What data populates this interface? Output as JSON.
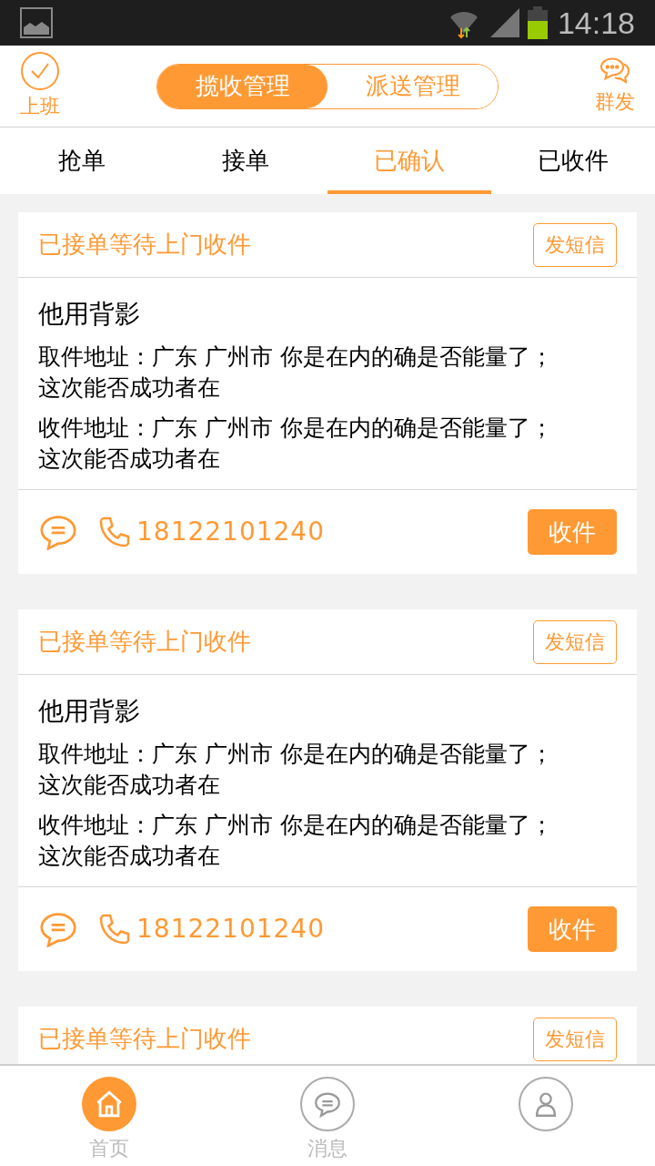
{
  "status_bar": {
    "time": "14:18"
  },
  "header": {
    "left_action": "上班",
    "right_action": "群发",
    "segments": [
      {
        "label": "揽收管理",
        "selected": true
      },
      {
        "label": "派送管理",
        "selected": false
      }
    ]
  },
  "tabs": [
    {
      "label": "抢单",
      "selected": false
    },
    {
      "label": "接单",
      "selected": false
    },
    {
      "label": "已确认",
      "selected": true
    },
    {
      "label": "已收件",
      "selected": false
    }
  ],
  "orders": [
    {
      "status": "已接单等待上门收件",
      "sms_button": "发短信",
      "name": "他用背影",
      "pickup": "取件地址：广东 广州市 你是在内的确是否能量了；这次能否成功者在",
      "delivery": "收件地址：广东 广州市 你是在内的确是否能量了；这次能否成功者在",
      "phone": "18122101240",
      "action": "收件"
    },
    {
      "status": "已接单等待上门收件",
      "sms_button": "发短信",
      "name": "他用背影",
      "pickup": "取件地址：广东 广州市 你是在内的确是否能量了；这次能否成功者在",
      "delivery": "收件地址：广东 广州市 你是在内的确是否能量了；这次能否成功者在",
      "phone": "18122101240",
      "action": "收件"
    },
    {
      "status": "已接单等待上门收件",
      "sms_button": "发短信"
    }
  ],
  "bottom_nav": [
    {
      "kind": "home",
      "label": "首页",
      "selected": true
    },
    {
      "kind": "message",
      "label": "消息",
      "selected": false
    },
    {
      "kind": "profile",
      "selected": false
    }
  ]
}
